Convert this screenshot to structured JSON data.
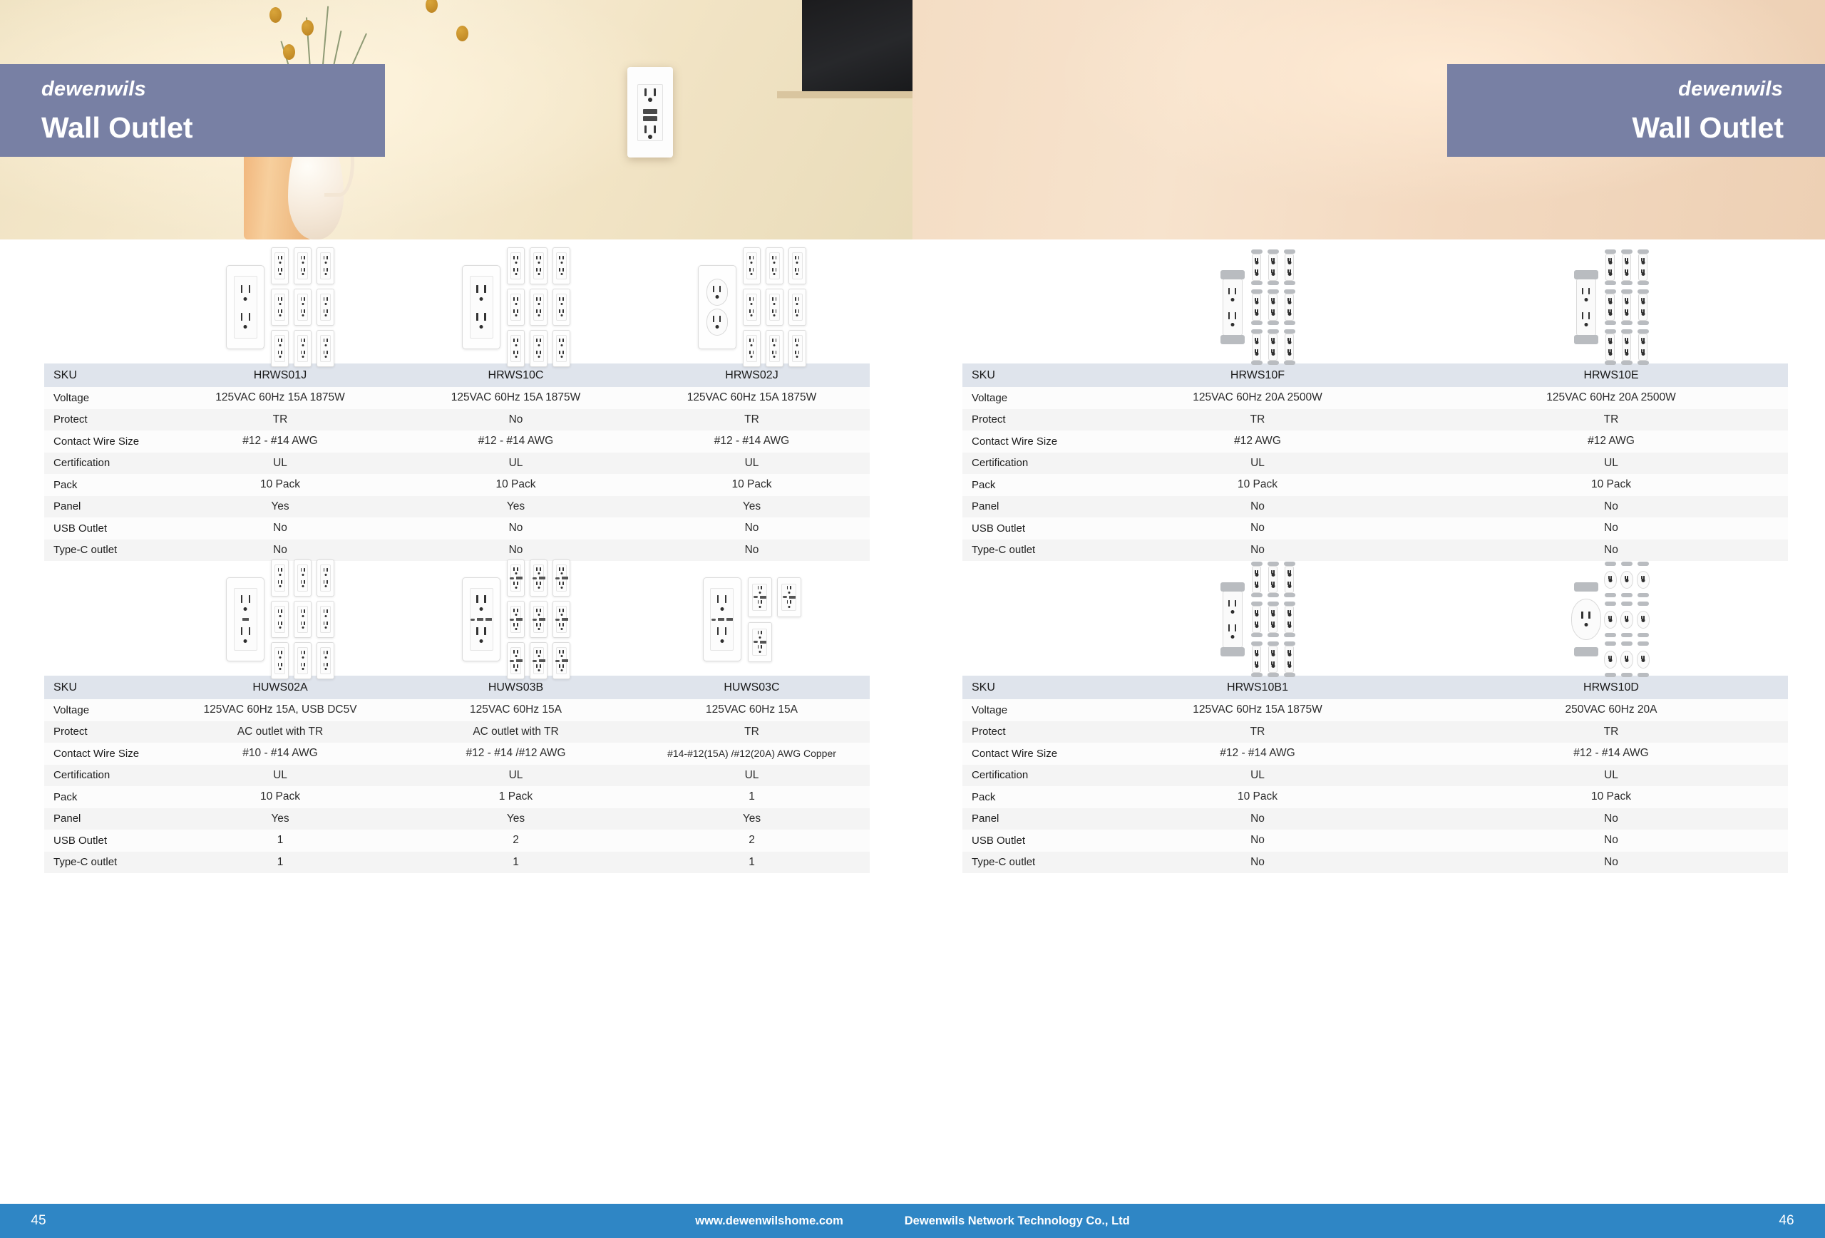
{
  "brand": {
    "name": "dewenwils",
    "mark": "d"
  },
  "banners": {
    "left": {
      "brand": "dewenwils",
      "title": "Wall Outlet"
    },
    "right": {
      "brand": "dewenwils",
      "title": "Wall Outlet"
    }
  },
  "spec_rows": [
    "SKU",
    "Voltage",
    "Protect",
    "Contact Wire Size",
    "Certification",
    "Pack",
    "Panel",
    "USB Outlet",
    "Type-C outlet"
  ],
  "tables": [
    {
      "id": "table-left-top",
      "label_column": [
        "SKU",
        "Voltage",
        "Protect",
        "Contact Wire Size",
        "Certification",
        "Pack",
        "Panel",
        "USB Outlet",
        "Type-C outlet"
      ],
      "products": [
        {
          "sku": "HRWS01J",
          "style": "plate-duplex",
          "voltage": "125VAC 60Hz 15A 1875W",
          "protect": "TR",
          "contact_wire_size": "#12 - #14 AWG",
          "certification": "UL",
          "pack": "10 Pack",
          "panel": "Yes",
          "usb_outlet": "No",
          "type_c_outlet": "No"
        },
        {
          "sku": "HRWS10C",
          "style": "plate-duplex",
          "voltage": "125VAC 60Hz 15A 1875W",
          "protect": "No",
          "contact_wire_size": "#12 - #14 AWG",
          "certification": "UL",
          "pack": "10 Pack",
          "panel": "Yes",
          "usb_outlet": "No",
          "type_c_outlet": "No"
        },
        {
          "sku": "HRWS02J",
          "style": "plate-round",
          "voltage": "125VAC 60Hz 15A 1875W",
          "protect": "TR",
          "contact_wire_size": "#12 - #14 AWG",
          "certification": "UL",
          "pack": "10 Pack",
          "panel": "Yes",
          "usb_outlet": "No",
          "type_c_outlet": "No"
        }
      ]
    },
    {
      "id": "table-left-bottom",
      "label_column": [
        "SKU",
        "Voltage",
        "Protect",
        "Contact Wire Size",
        "Certification",
        "Pack",
        "Panel",
        "USB Outlet",
        "Type-C outlet"
      ],
      "products": [
        {
          "sku": "HUWS02A",
          "style": "plate-usb1",
          "voltage": "125VAC 60Hz 15A, USB DC5V",
          "protect": "AC outlet with TR",
          "contact_wire_size": "#10 - #14 AWG",
          "certification": "UL",
          "pack": "10 Pack",
          "panel": "Yes",
          "usb_outlet": "1",
          "type_c_outlet": "1"
        },
        {
          "sku": "HUWS03B",
          "style": "plate-usb3",
          "voltage": "125VAC 60Hz 15A",
          "protect": "AC outlet with TR",
          "contact_wire_size": "#12 - #14 /#12 AWG",
          "certification": "UL",
          "pack": "1 Pack",
          "panel": "Yes",
          "usb_outlet": "2",
          "type_c_outlet": "1"
        },
        {
          "sku": "HUWS03C",
          "style": "plate-usb3-trio",
          "voltage": "125VAC 60Hz 15A",
          "protect": "TR",
          "contact_wire_size": "#14-#12(15A) /#12(20A) AWG Copper",
          "certification": "UL",
          "pack": "1",
          "panel": "Yes",
          "usb_outlet": "2",
          "type_c_outlet": "1"
        }
      ]
    },
    {
      "id": "table-right-top",
      "label_column": [
        "SKU",
        "Voltage",
        "Protect",
        "Contact Wire Size",
        "Certification",
        "Pack",
        "Panel",
        "USB Outlet",
        "Type-C outlet"
      ],
      "products": [
        {
          "sku": "HRWS10F",
          "style": "bare-duplex",
          "voltage": "125VAC 60Hz 20A 2500W",
          "protect": "TR",
          "contact_wire_size": "#12 AWG",
          "certification": "UL",
          "pack": "10 Pack",
          "panel": "No",
          "usb_outlet": "No",
          "type_c_outlet": "No"
        },
        {
          "sku": "HRWS10E",
          "style": "bare-decor",
          "voltage": "125VAC 60Hz 20A 2500W",
          "protect": "TR",
          "contact_wire_size": "#12 AWG",
          "certification": "UL",
          "pack": "10 Pack",
          "panel": "No",
          "usb_outlet": "No",
          "type_c_outlet": "No"
        }
      ]
    },
    {
      "id": "table-right-bottom",
      "label_column": [
        "SKU",
        "Voltage",
        "Protect",
        "Contact Wire Size",
        "Certification",
        "Pack",
        "Panel",
        "USB Outlet",
        "Type-C outlet"
      ],
      "products": [
        {
          "sku": "HRWS10B1",
          "style": "bare-decor",
          "voltage": "125VAC 60Hz 15A 1875W",
          "protect": "TR",
          "contact_wire_size": "#12 - #14 AWG",
          "certification": "UL",
          "pack": "10 Pack",
          "panel": "No",
          "usb_outlet": "No",
          "type_c_outlet": "No"
        },
        {
          "sku": "HRWS10D",
          "style": "bare-round",
          "voltage": "250VAC 60Hz 20A",
          "protect": "TR",
          "contact_wire_size": "#12 - #14 AWG",
          "certification": "UL",
          "pack": "10 Pack",
          "panel": "No",
          "usb_outlet": "No",
          "type_c_outlet": "No"
        }
      ]
    }
  ],
  "footer": {
    "page_left": "45",
    "page_right": "46",
    "website": "www.dewenwilshome.com",
    "company": "Dewenwils Network Technology Co., Ltd"
  },
  "colors": {
    "band": "#7880a4",
    "footer": "#2f86c5",
    "table_header": "#dfe4ec",
    "row_odd": "#f4f4f4",
    "row_even": "#fcfcfc"
  }
}
